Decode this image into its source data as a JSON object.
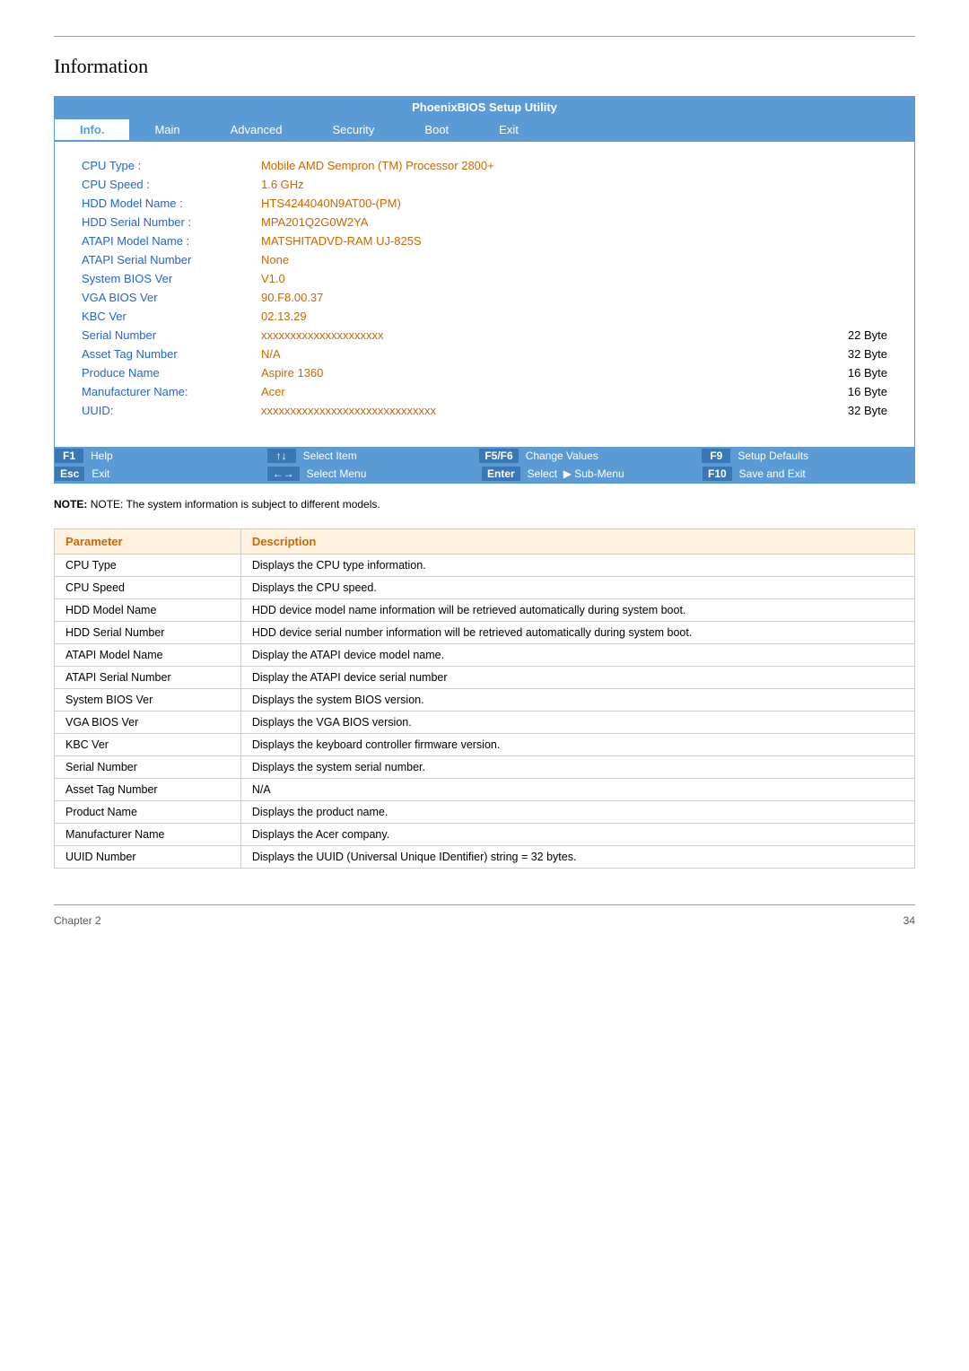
{
  "page": {
    "title": "Information",
    "chapter_label": "Chapter 2",
    "page_number": "34"
  },
  "bios": {
    "title_bar": "PhoenixBIOS Setup Utility",
    "nav_items": [
      {
        "label": "Info.",
        "active": true
      },
      {
        "label": "Main",
        "active": false
      },
      {
        "label": "Advanced",
        "active": false
      },
      {
        "label": "Security",
        "active": false
      },
      {
        "label": "Boot",
        "active": false
      },
      {
        "label": "Exit",
        "active": false
      }
    ],
    "info_rows": [
      {
        "label": "CPU Type :",
        "value": "Mobile AMD Sempron (TM) Processor 2800+",
        "size": ""
      },
      {
        "label": "CPU Speed :",
        "value": "1.6 GHz",
        "size": ""
      },
      {
        "label": "HDD Model Name :",
        "value": "HTS4244040N9AT00-(PM)",
        "size": ""
      },
      {
        "label": "HDD Serial Number :",
        "value": "MPA201Q2G0W2YA",
        "size": ""
      },
      {
        "label": "ATAPI Model Name :",
        "value": "MATSHITADVD-RAM UJ-825S",
        "size": ""
      },
      {
        "label": "ATAPI Serial Number",
        "value": "None",
        "size": ""
      },
      {
        "label": "System BIOS Ver",
        "value": "V1.0",
        "size": ""
      },
      {
        "label": "VGA BIOS Ver",
        "value": "90.F8.00.37",
        "size": ""
      },
      {
        "label": "KBC Ver",
        "value": "02.13.29",
        "size": ""
      },
      {
        "label": "Serial Number",
        "value": "xxxxxxxxxxxxxxxxxxxxx",
        "size": "22 Byte"
      },
      {
        "label": "Asset Tag Number",
        "value": "N/A",
        "size": "32 Byte"
      },
      {
        "label": "Produce Name",
        "value": "Aspire 1360",
        "size": "16 Byte"
      },
      {
        "label": "Manufacturer Name:",
        "value": "Acer",
        "size": "16 Byte"
      },
      {
        "label": "UUID:",
        "value": "xxxxxxxxxxxxxxxxxxxxxxxxxxxxxx",
        "size": "32 Byte"
      }
    ],
    "status_rows": [
      [
        {
          "key": "F1",
          "desc": "Help"
        },
        {
          "key": "↑↓",
          "desc": "Select Item"
        },
        {
          "key": "F5/F6",
          "desc": "Change Values"
        },
        {
          "key": "F9",
          "desc": "Setup Defaults"
        }
      ],
      [
        {
          "key": "Esc",
          "desc": "Exit"
        },
        {
          "key": "←→",
          "desc": "Select Menu"
        },
        {
          "key": "Enter",
          "desc": "Select  ▶ Sub-Menu"
        },
        {
          "key": "F10",
          "desc": "Save and Exit"
        }
      ]
    ]
  },
  "note": "NOTE: The system information is subject to different models.",
  "param_table": {
    "headers": [
      "Parameter",
      "Description"
    ],
    "rows": [
      {
        "param": "CPU Type",
        "desc": "Displays the CPU type information."
      },
      {
        "param": "CPU Speed",
        "desc": "Displays the CPU speed."
      },
      {
        "param": "HDD Model Name",
        "desc": "HDD device model name information will be retrieved automatically during system boot."
      },
      {
        "param": "HDD Serial Number",
        "desc": "HDD device serial number information will be retrieved automatically during system boot."
      },
      {
        "param": "ATAPI Model Name",
        "desc": "Display the ATAPI device model name."
      },
      {
        "param": "ATAPI Serial Number",
        "desc": "Display the ATAPI device serial number"
      },
      {
        "param": "System BIOS Ver",
        "desc": "Displays the system BIOS version."
      },
      {
        "param": "VGA BIOS Ver",
        "desc": "Displays the VGA BIOS version."
      },
      {
        "param": "KBC Ver",
        "desc": "Displays the keyboard controller firmware version."
      },
      {
        "param": "Serial Number",
        "desc": "Displays the system serial number."
      },
      {
        "param": "Asset Tag Number",
        "desc": "N/A"
      },
      {
        "param": "Product Name",
        "desc": "Displays the product name."
      },
      {
        "param": "Manufacturer Name",
        "desc": "Displays the Acer company."
      },
      {
        "param": "UUID Number",
        "desc": "Displays the UUID (Universal Unique IDentifier) string = 32 bytes."
      }
    ]
  }
}
